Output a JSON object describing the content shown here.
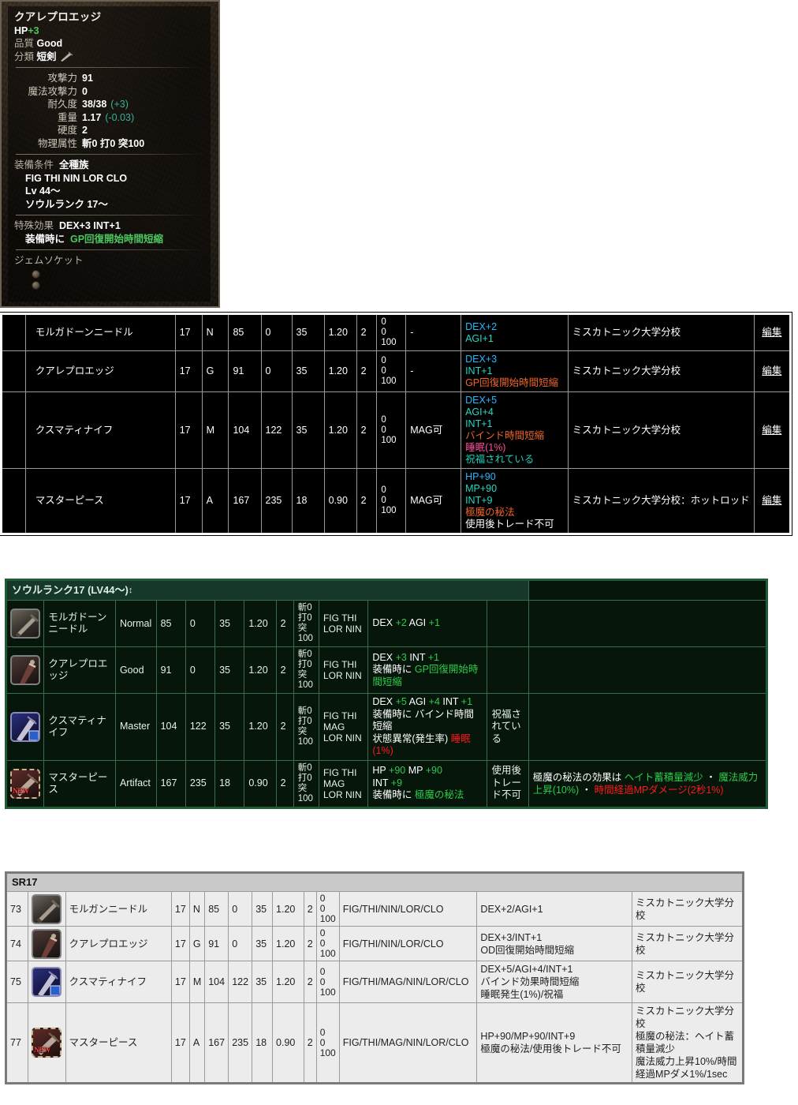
{
  "tooltip": {
    "title": "クアレプロエッジ",
    "hp_label": "HP",
    "hp_value": "+3",
    "quality_label": "品質",
    "quality_value": "Good",
    "category_label": "分類",
    "category_value": "短剣",
    "stats": [
      {
        "label": "攻撃力",
        "value": "91",
        "extra": ""
      },
      {
        "label": "魔法攻撃力",
        "value": "0",
        "extra": ""
      },
      {
        "label": "耐久度",
        "value": "38/38",
        "extra": "(+3)"
      },
      {
        "label": "重量",
        "value": "1.17",
        "extra": "(-0.03)"
      },
      {
        "label": "硬度",
        "value": "2",
        "extra": ""
      },
      {
        "label": "物理属性",
        "value": "斬0 打0 突100",
        "extra": ""
      }
    ],
    "req_label": "装備条件",
    "req_value": "全種族",
    "req_jobs": "FIG THI NIN LOR CLO",
    "req_level": "Lv 44〜",
    "req_soulrank": "ソウルランク 17〜",
    "special_label": "特殊効果",
    "special_value": "DEX+3 INT+1",
    "equip_prefix": "装備時に",
    "equip_effect": "GP回復開始時間短縮",
    "socket_label": "ジェムソケット",
    "socket_count": 2
  },
  "table1": {
    "edit_label": "編集",
    "rows": [
      {
        "name": "モルガドーンニードル",
        "sr": "17",
        "quality": "N",
        "quality_class": "q-N",
        "atk": "85",
        "matk": "0",
        "dur": "35",
        "weight": "1.20",
        "hard": "2",
        "elem": "0\n0\n100",
        "mag": "-",
        "effects": [
          {
            "text": "DEX+2",
            "color": "e-blue"
          },
          {
            "text": "AGI+1",
            "color": "e-cyan"
          }
        ],
        "source": "ミスカトニック大学分校"
      },
      {
        "name": "クアレプロエッジ",
        "sr": "17",
        "quality": "G",
        "quality_class": "q-G",
        "atk": "91",
        "matk": "0",
        "dur": "35",
        "weight": "1.20",
        "hard": "2",
        "elem": "0\n0\n100",
        "mag": "-",
        "effects": [
          {
            "text": "DEX+3",
            "color": "e-blue"
          },
          {
            "text": "INT+1",
            "color": "e-cyan"
          },
          {
            "text": "GP回復開始時間短縮",
            "color": "e-orange"
          }
        ],
        "source": "ミスカトニック大学分校"
      },
      {
        "name": "クスマティナイフ",
        "sr": "17",
        "quality": "M",
        "quality_class": "q-M",
        "atk": "104",
        "matk": "122",
        "dur": "35",
        "weight": "1.20",
        "hard": "2",
        "elem": "0\n0\n100",
        "mag": "MAG可",
        "effects": [
          {
            "text": "DEX+5",
            "color": "e-blue"
          },
          {
            "text": "AGI+4",
            "color": "e-cyan"
          },
          {
            "text": "INT+1",
            "color": "e-cyan"
          },
          {
            "text": "バインド時間短縮",
            "color": "e-orange"
          },
          {
            "text": "睡眠(1%)",
            "color": "e-pink"
          },
          {
            "text": "祝福されている",
            "color": "e-teal2"
          }
        ],
        "source": "ミスカトニック大学分校"
      },
      {
        "name": "マスターピース",
        "sr": "17",
        "quality": "A",
        "quality_class": "q-A",
        "atk": "167",
        "matk": "235",
        "dur": "18",
        "weight": "0.90",
        "hard": "2",
        "elem": "0\n0\n100",
        "mag": "MAG可",
        "effects": [
          {
            "text": "HP+90",
            "color": "e-blue"
          },
          {
            "text": "MP+90",
            "color": "e-cyan"
          },
          {
            "text": "INT+9",
            "color": "e-cyan"
          },
          {
            "text": "極魔の秘法",
            "color": "e-orange"
          },
          {
            "text": "使用後トレード不可",
            "color": "e-white"
          }
        ],
        "source": "ミスカトニック大学分校：ホットロッド"
      }
    ]
  },
  "table2": {
    "header": "ソウルランク17 (LV44〜)",
    "header_arrow": "↕",
    "rows": [
      {
        "icon": "needle-icon",
        "name": "モルガドーンニードル",
        "quality": "Normal",
        "quality_class": "g-Normal",
        "atk": "85",
        "matk": "0",
        "dur": "35",
        "weight": "1.20",
        "hard": "2",
        "elem": "斬0\n打0\n突\n100",
        "jobs": "FIG THI\nLOR NIN",
        "effect_parts": [
          {
            "t": "DEX ",
            "c": "gp-white"
          },
          {
            "t": "+2 ",
            "c": "gp-green"
          },
          {
            "t": "AGI ",
            "c": "gp-white"
          },
          {
            "t": "+1",
            "c": "gp-green"
          }
        ],
        "special": "",
        "note": ""
      },
      {
        "icon": "quale-icon",
        "name": "クアレプロエッジ",
        "quality": "Good",
        "quality_class": "g-Good",
        "atk": "91",
        "matk": "0",
        "dur": "35",
        "weight": "1.20",
        "hard": "2",
        "elem": "斬0\n打0\n突\n100",
        "jobs": "FIG THI\nLOR NIN",
        "effect_parts": [
          {
            "t": "DEX ",
            "c": "gp-white"
          },
          {
            "t": "+3 ",
            "c": "gp-green"
          },
          {
            "t": "INT ",
            "c": "gp-white"
          },
          {
            "t": "+1",
            "c": "gp-green"
          },
          {
            "t": "\n",
            "c": ""
          },
          {
            "t": "装備時に ",
            "c": "gp-white"
          },
          {
            "t": "GP回復開始時間短縮",
            "c": "gp-green"
          }
        ],
        "special": "",
        "note": ""
      },
      {
        "icon": "kusu-icon",
        "name": "クスマティナイフ",
        "quality": "Master",
        "quality_class": "g-Master",
        "atk": "104",
        "matk": "122",
        "dur": "35",
        "weight": "1.20",
        "hard": "2",
        "elem": "斬0\n打0\n突\n100",
        "jobs": "FIG THI\nMAG\nLOR NIN",
        "effect_parts": [
          {
            "t": "DEX ",
            "c": "gp-white"
          },
          {
            "t": "+5 ",
            "c": "gp-green"
          },
          {
            "t": "AGI ",
            "c": "gp-white"
          },
          {
            "t": "+4 ",
            "c": "gp-green"
          },
          {
            "t": "INT ",
            "c": "gp-white"
          },
          {
            "t": "+1",
            "c": "gp-green"
          },
          {
            "t": "\n",
            "c": ""
          },
          {
            "t": "装備時に バインド時間短縮",
            "c": "gp-white"
          },
          {
            "t": "\n",
            "c": ""
          },
          {
            "t": "状態異常(発生率) ",
            "c": "gp-white"
          },
          {
            "t": "睡眠 (1%)",
            "c": "gp-red"
          }
        ],
        "special": "祝福されている",
        "special_class": "gp-yellow",
        "note": ""
      },
      {
        "icon": "master-icon",
        "name": "マスターピース",
        "quality": "Artifact",
        "quality_class": "g-Artifact",
        "atk": "167",
        "matk": "235",
        "dur": "18",
        "weight": "0.90",
        "hard": "2",
        "elem": "斬0\n打0\n突\n100",
        "jobs": "FIG THI\nMAG\nLOR NIN",
        "effect_parts": [
          {
            "t": "HP ",
            "c": "gp-white"
          },
          {
            "t": "+90 ",
            "c": "gp-green"
          },
          {
            "t": "MP ",
            "c": "gp-white"
          },
          {
            "t": "+90",
            "c": "gp-green"
          },
          {
            "t": "\n",
            "c": ""
          },
          {
            "t": "INT ",
            "c": "gp-white"
          },
          {
            "t": "+9",
            "c": "gp-green"
          },
          {
            "t": "\n",
            "c": ""
          },
          {
            "t": "装備時に ",
            "c": "gp-white"
          },
          {
            "t": "極魔の秘法",
            "c": "gp-green"
          }
        ],
        "special": "使用後トレード不可",
        "special_class": "gp-white",
        "note_parts": [
          {
            "t": "極魔の秘法の効果は ",
            "c": "gp-white"
          },
          {
            "t": "ヘイト蓄積量減少",
            "c": "gp-green"
          },
          {
            "t": " ・ ",
            "c": "gp-white"
          },
          {
            "t": "魔法威力上昇(10%)",
            "c": "gp-green"
          },
          {
            "t": " ・ ",
            "c": "gp-white"
          },
          {
            "t": "時間経過MPダメージ(2秒1%)",
            "c": "gp-red"
          }
        ]
      }
    ]
  },
  "table3": {
    "header": "SR17",
    "rows": [
      {
        "id": "73",
        "icon": "needle-icon",
        "name": "モルガンニードル",
        "sr": "17",
        "quality": "N",
        "atk": "85",
        "matk": "0",
        "dur": "35",
        "weight": "1.20",
        "hard": "2",
        "elem": "0\n0\n100",
        "jobs": "FIG/THI/NIN/LOR/CLO",
        "effect": "DEX+2/AGI+1",
        "source": "ミスカトニック大学分校"
      },
      {
        "id": "74",
        "icon": "quale-icon",
        "name": "クアレプロエッジ",
        "sr": "17",
        "quality": "G",
        "atk": "91",
        "matk": "0",
        "dur": "35",
        "weight": "1.20",
        "hard": "2",
        "elem": "0\n0\n100",
        "jobs": "FIG/THI/NIN/LOR/CLO",
        "effect": "DEX+3/INT+1\nOD回復開始時間短縮",
        "source": "ミスカトニック大学分校"
      },
      {
        "id": "75",
        "icon": "kusu-icon",
        "name": "クスマティナイフ",
        "sr": "17",
        "quality": "M",
        "atk": "104",
        "matk": "122",
        "dur": "35",
        "weight": "1.20",
        "hard": "2",
        "elem": "0\n0\n100",
        "jobs": "FIG/THI/MAG/NIN/LOR/CLO",
        "effect": "DEX+5/AGI+4/INT+1\nバインド効果時間短縮\n睡眠発生(1%)/祝福",
        "source": "ミスカトニック大学分校"
      },
      {
        "id": "77",
        "icon": "master-icon",
        "name": "マスターピース",
        "sr": "17",
        "quality": "A",
        "atk": "167",
        "matk": "235",
        "dur": "18",
        "weight": "0.90",
        "hard": "2",
        "elem": "0\n0\n100",
        "jobs": "FIG/THI/MAG/NIN/LOR/CLO",
        "effect": "HP+90/MP+90/INT+9\n極魔の秘法/使用後トレード不可",
        "source": "ミスカトニック大学分校\n極魔の秘法：ヘイト蓄積量減少\n魔法威力上昇10%/時間経過MPダメ1%/1sec"
      }
    ]
  }
}
